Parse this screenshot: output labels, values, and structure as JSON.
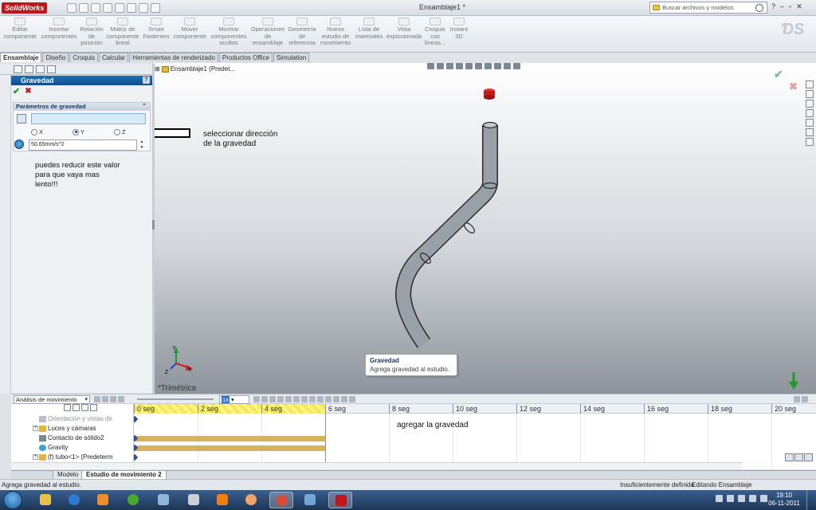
{
  "app": {
    "logo": "SolidWorks",
    "document_title": "Ensamblaje1 *",
    "search_placeholder": "Buscar archivos y modelos",
    "window_controls": [
      "?",
      "–",
      "▫",
      "✕"
    ]
  },
  "command_manager": {
    "buttons": [
      {
        "label": "Editar componente"
      },
      {
        "label": "Insertar componentes"
      },
      {
        "label": "Relación de posición"
      },
      {
        "label": "Matriz de componente lineal"
      },
      {
        "label": "Smart Fasteners"
      },
      {
        "label": "Mover componente"
      },
      {
        "label": "Mostrar componentes ocultos"
      },
      {
        "label": "Operaciones de ensamblaje"
      },
      {
        "label": "Geometría de referencia"
      },
      {
        "label": "Nuevo estudio de movimiento"
      },
      {
        "label": "Lista de materiales"
      },
      {
        "label": "Vista explosionada"
      },
      {
        "label": "Croquis con líneas..."
      },
      {
        "label": "Instant 3D"
      }
    ]
  },
  "tabs": [
    "Ensamblaje",
    "Diseño",
    "Croquis",
    "Calcular",
    "Herramientas de renderizado",
    "Productos Office",
    "Simulation"
  ],
  "property_manager": {
    "title": "Gravedad",
    "help": "?",
    "ok": "✔",
    "cancel": "✖",
    "group_title": "Parámetros de gravedad",
    "direction_options": [
      {
        "label": "X",
        "selected": false
      },
      {
        "label": "Y",
        "selected": true
      },
      {
        "label": "Z",
        "selected": false
      }
    ],
    "gravity_value": "50.65mm/s^2"
  },
  "annotations": {
    "left_note": "puedes reducir este valor para que vaya mas lento!!!",
    "direction_note": "seleccionar dirección de la gravedad",
    "add_gravity_note": "agregar la gravedad"
  },
  "viewport": {
    "tree_flyout": "Ensamblaje1  (Predet...",
    "view_name": "*Trimétrica",
    "axis_labels": {
      "x": "X",
      "y": "Y",
      "z": "Z"
    }
  },
  "tooltip": {
    "title": "Gravedad",
    "body": "Agrega gravedad al estudio."
  },
  "motion_manager": {
    "study_type": "Análisis de movimiento",
    "playback_speed": "1x",
    "tree_rows": [
      {
        "label": "Orientación y vistas de",
        "dim": true
      },
      {
        "label": "Luces y cámaras",
        "dim": false
      },
      {
        "label": "Contacto de sólido2",
        "dim": false
      },
      {
        "label": "Gravity",
        "dim": false
      },
      {
        "label": "(f) tubo<1> (Predeterm",
        "dim": false
      }
    ],
    "ticks": [
      "0 seg",
      "2 seg",
      "4 seg",
      "6 seg",
      "8 seg",
      "10 seg",
      "12 seg",
      "14 seg",
      "16 seg",
      "18 seg",
      "20 seg"
    ],
    "bottom_tabs": [
      "Modelo",
      "Estudio de movimiento 2"
    ]
  },
  "status_bar": {
    "message": "Agrega gravedad al estudio.",
    "definition": "Insuficientemente definida",
    "mode": "Editando Ensamblaje"
  },
  "taskbar": {
    "time": "19:10",
    "date": "06-11-2011"
  }
}
